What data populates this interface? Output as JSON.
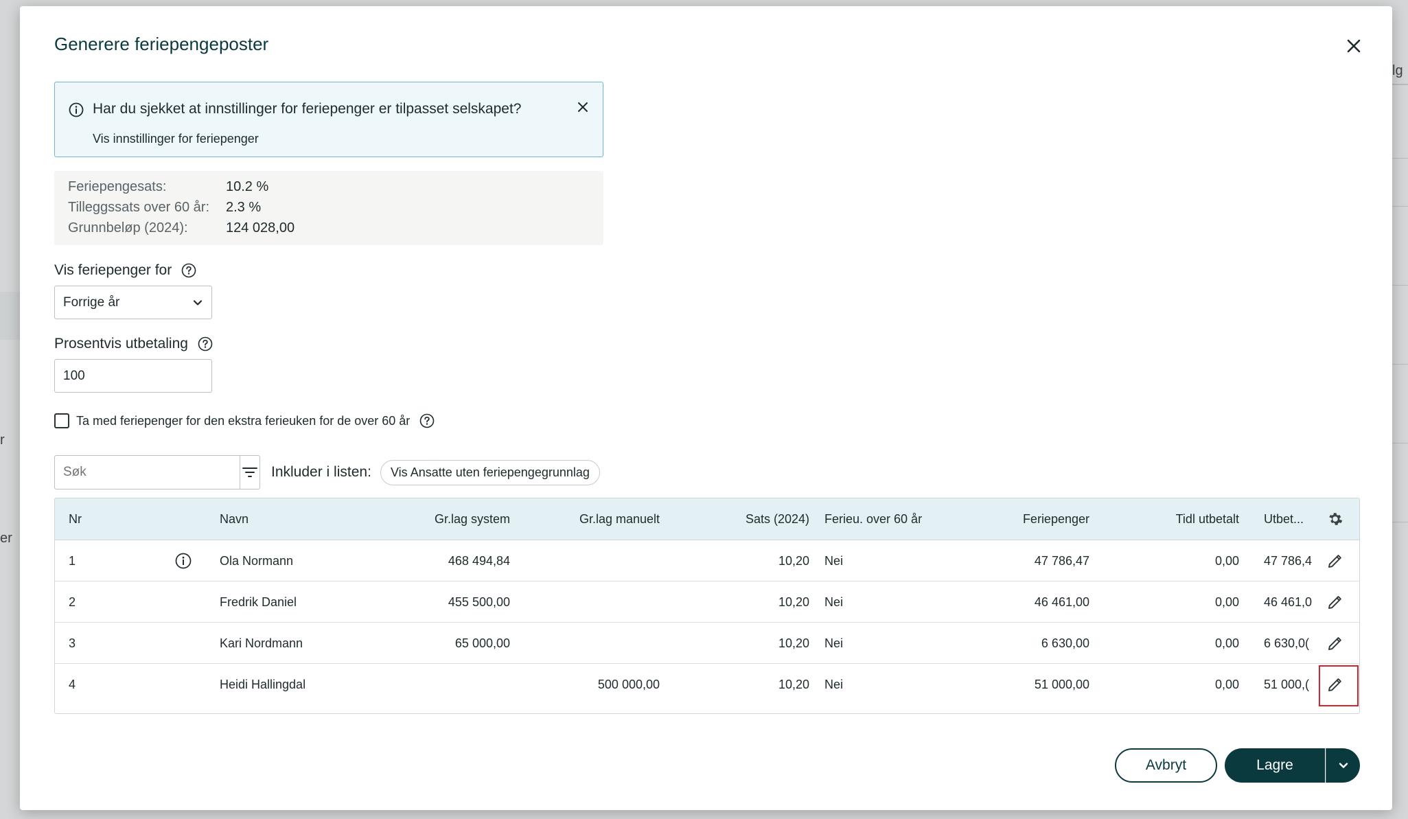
{
  "background": {
    "fragments": [
      "r",
      "er",
      "lg"
    ]
  },
  "modal": {
    "title": "Generere feriepengeposter"
  },
  "banner": {
    "message": "Har du sjekket at innstillinger for feriepenger er tilpasset selskapet?",
    "link": "Vis innstillinger for feriepenger"
  },
  "summary": [
    {
      "label": "Feriepengesats:",
      "value": "10.2 %"
    },
    {
      "label": "Tilleggssats over 60 år:",
      "value": "2.3 %"
    },
    {
      "label": "Grunnbeløp (2024):",
      "value": "124 028,00"
    }
  ],
  "form": {
    "period_label": "Vis feriepenger for",
    "period_value": "Forrige år",
    "percent_label": "Prosentvis utbetaling",
    "percent_value": "100",
    "checkbox_label": "Ta med feriepenger for den ekstra ferieuken for de over 60 år"
  },
  "search": {
    "placeholder": "Søk",
    "include_label": "Inkluder i listen:",
    "chip": "Vis Ansatte uten feriepengegrunnlag"
  },
  "table": {
    "headers": [
      "Nr",
      "Navn",
      "Gr.lag system",
      "Gr.lag manuelt",
      "Sats (2024)",
      "Ferieu. over 60 år",
      "Feriepenger",
      "Tidl utbetalt",
      "Utbet..."
    ],
    "rows": [
      {
        "nr": "1",
        "navn": "Ola Normann",
        "system": "468 494,84",
        "manuelt": "",
        "sats": "10,20",
        "over60": "Nei",
        "feriepenger": "47 786,47",
        "tidl": "0,00",
        "utbet": "47 786,4"
      },
      {
        "nr": "2",
        "navn": "Fredrik Daniel",
        "system": "455 500,00",
        "manuelt": "",
        "sats": "10,20",
        "over60": "Nei",
        "feriepenger": "46 461,00",
        "tidl": "0,00",
        "utbet": "46 461,0"
      },
      {
        "nr": "3",
        "navn": "Kari Nordmann",
        "system": "65 000,00",
        "manuelt": "",
        "sats": "10,20",
        "over60": "Nei",
        "feriepenger": "6 630,00",
        "tidl": "0,00",
        "utbet": "6 630,0("
      },
      {
        "nr": "4",
        "navn": "Heidi Hallingdal",
        "system": "",
        "manuelt": "500 000,00",
        "sats": "10,20",
        "over60": "Nei",
        "feriepenger": "51 000,00",
        "tidl": "0,00",
        "utbet": "51 000,("
      }
    ]
  },
  "footer": {
    "cancel": "Avbryt",
    "save": "Lagre"
  },
  "colors": {
    "primary": "#0b3a3e",
    "banner_bg": "#eef8fb",
    "banner_border": "#6fb7cc",
    "table_header": "#e3f1f5",
    "highlight": "#d1242f"
  }
}
